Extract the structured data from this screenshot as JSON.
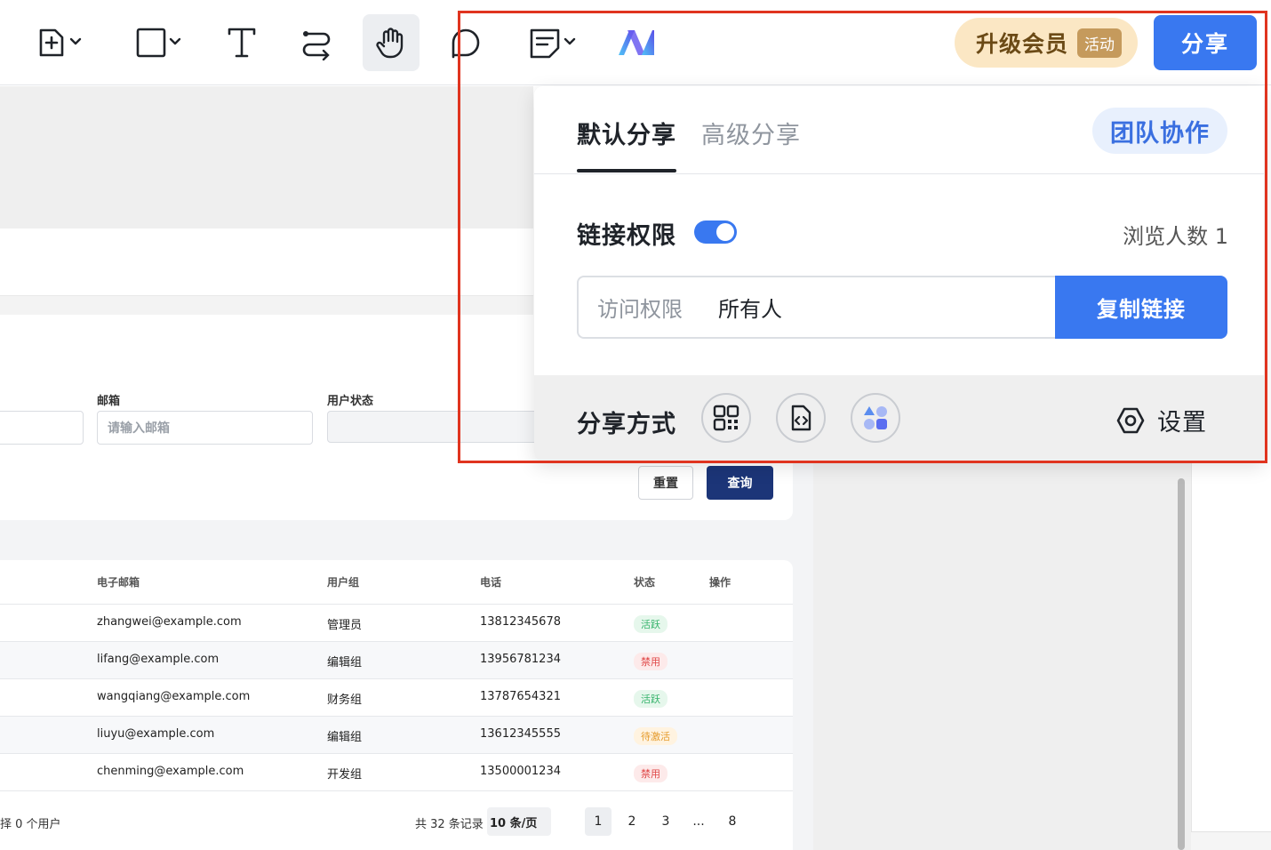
{
  "toolbar": {
    "tools": [
      {
        "name": "insert-frame-icon",
        "has_dropdown": true
      },
      {
        "name": "rectangle-icon",
        "has_dropdown": true
      },
      {
        "name": "text-tool-icon",
        "has_dropdown": false
      },
      {
        "name": "connector-icon",
        "has_dropdown": false
      },
      {
        "name": "hand-tool-icon",
        "has_dropdown": false,
        "active": true
      },
      {
        "name": "comment-bubble-icon",
        "has_dropdown": false
      },
      {
        "name": "sticky-note-icon",
        "has_dropdown": true
      },
      {
        "name": "ai-logo-icon",
        "has_dropdown": false
      }
    ],
    "upgrade_label": "升级会员",
    "upgrade_tag": "活动",
    "share_label": "分享"
  },
  "share_popup": {
    "tabs": [
      "默认分享",
      "高级分享"
    ],
    "active_tab": 0,
    "team_button": "团队协作",
    "link_permission_label": "链接权限",
    "link_permission_enabled": true,
    "viewers_label": "浏览人数 1",
    "access_key": "访问权限",
    "access_value": "所有人",
    "copy_link_label": "复制链接",
    "share_method_label": "分享方式",
    "share_methods": [
      "qr-code-icon",
      "embed-code-icon",
      "apps-icon"
    ],
    "settings_label": "设置"
  },
  "background_page": {
    "filters": {
      "email_label": "邮箱",
      "email_placeholder": "请输入邮箱",
      "status_label": "用户状态",
      "reset_label": "重置",
      "query_label": "查询"
    },
    "table": {
      "headers": [
        "电子邮箱",
        "用户组",
        "电话",
        "状态",
        "操作"
      ],
      "rows": [
        {
          "email": "zhangwei@example.com",
          "group": "管理员",
          "phone": "13812345678",
          "status": "活跃",
          "status_color": "green"
        },
        {
          "email": "lifang@example.com",
          "group": "编辑组",
          "phone": "13956781234",
          "status": "禁用",
          "status_color": "red"
        },
        {
          "email": "wangqiang@example.com",
          "group": "财务组",
          "phone": "13787654321",
          "status": "活跃",
          "status_color": "green"
        },
        {
          "email": "liuyu@example.com",
          "group": "编辑组",
          "phone": "13612345555",
          "status": "待激活",
          "status_color": "orange"
        },
        {
          "email": "chenming@example.com",
          "group": "开发组",
          "phone": "13500001234",
          "status": "禁用",
          "status_color": "red"
        }
      ]
    },
    "footer": {
      "selected_text": "择 0 个用户",
      "total_text": "共 32 条记录",
      "page_size": "10 条/页",
      "pages": [
        "1",
        "2",
        "3",
        "...",
        "8"
      ],
      "current_page": "1"
    }
  },
  "colors": {
    "accent": "#3978f0",
    "highlight_border": "#e0341f",
    "query_button": "#1c3578"
  }
}
